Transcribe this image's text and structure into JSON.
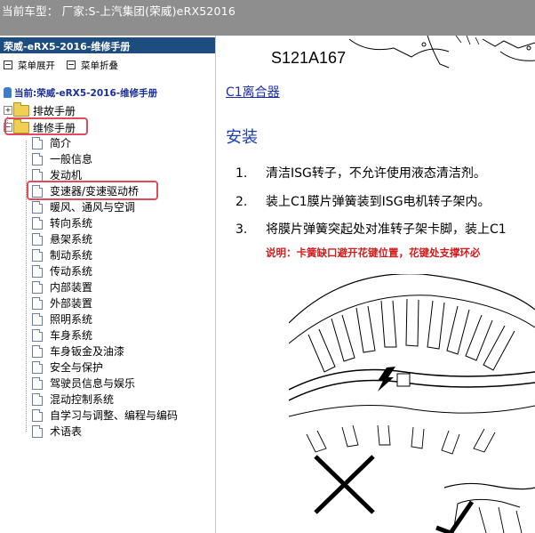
{
  "window": {
    "title": "当前车型：  厂家:S-上汽集团(荣威)eRX52016"
  },
  "sidebar": {
    "header": "荣威-eRX5-2016-维修手册",
    "expand_all": "菜单展开",
    "collapse_all": "菜单折叠",
    "current": "当前:荣威-eRX5-2016-维修手册",
    "folders": [
      {
        "label": "排故手册",
        "expander": "+"
      },
      {
        "label": "维修手册",
        "expander": "−"
      }
    ],
    "items": [
      {
        "label": "简介"
      },
      {
        "label": "一般信息"
      },
      {
        "label": "发动机"
      },
      {
        "label": "变速器/变速驱动桥"
      },
      {
        "label": "暖风、通风与空调"
      },
      {
        "label": "转向系统"
      },
      {
        "label": "悬架系统"
      },
      {
        "label": "制动系统"
      },
      {
        "label": "传动系统"
      },
      {
        "label": "内部装置"
      },
      {
        "label": "外部装置"
      },
      {
        "label": "照明系统"
      },
      {
        "label": "车身系统"
      },
      {
        "label": "车身钣金及油漆"
      },
      {
        "label": "安全与保护"
      },
      {
        "label": "驾驶员信息与娱乐"
      },
      {
        "label": "混动控制系统"
      },
      {
        "label": "自学习与调整、编程与编码"
      },
      {
        "label": "术语表"
      }
    ],
    "highlight_color": "#e04c5c"
  },
  "content": {
    "figure_code": "S121A167",
    "link": "C1离合器",
    "heading": "安装",
    "steps": [
      {
        "num": "1.",
        "text": "清洁ISG转子，不允许使用液态清洁剂。"
      },
      {
        "num": "2.",
        "text": "装上C1膜片弹簧装到ISG电机转子架内。"
      },
      {
        "num": "3.",
        "text": "将膜片弹簧突起处对准转子架卡脚，装上C1"
      }
    ],
    "note_label": "说明：",
    "note_text": "卡簧缺口避开花键位置，花键处支撑环必"
  },
  "colors": {
    "titlebar": "#8e8e8e",
    "header": "#1d4c7f",
    "link": "#1b2ea8",
    "heading": "#1b3fa8",
    "note": "#d21c1c"
  }
}
